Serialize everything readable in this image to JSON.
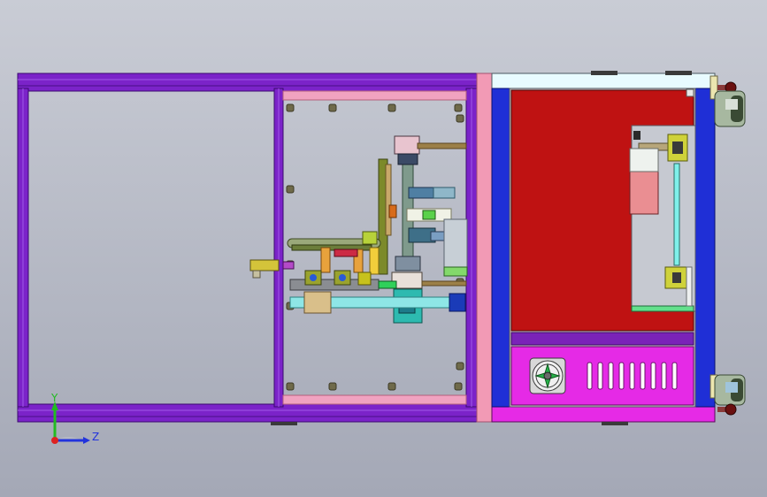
{
  "scene": {
    "background_top": "#c9ccd5",
    "background_bottom": "#a4a8b6",
    "frame_color": "#7b23c9",
    "frame_dark": "#4a0f86",
    "cabinet_red": "#bf1212",
    "panel_magenta": "#e52ae6",
    "side_blue": "#1f2fd6"
  },
  "triad": {
    "y_label": "Y",
    "z_label": "Z",
    "y_color": "#22bb22",
    "z_color": "#2233dd",
    "origin_color": "#dd2222"
  },
  "icons": [
    "axis-triad-icon",
    "cooling-fan-icon",
    "leveling-foot-icon"
  ]
}
